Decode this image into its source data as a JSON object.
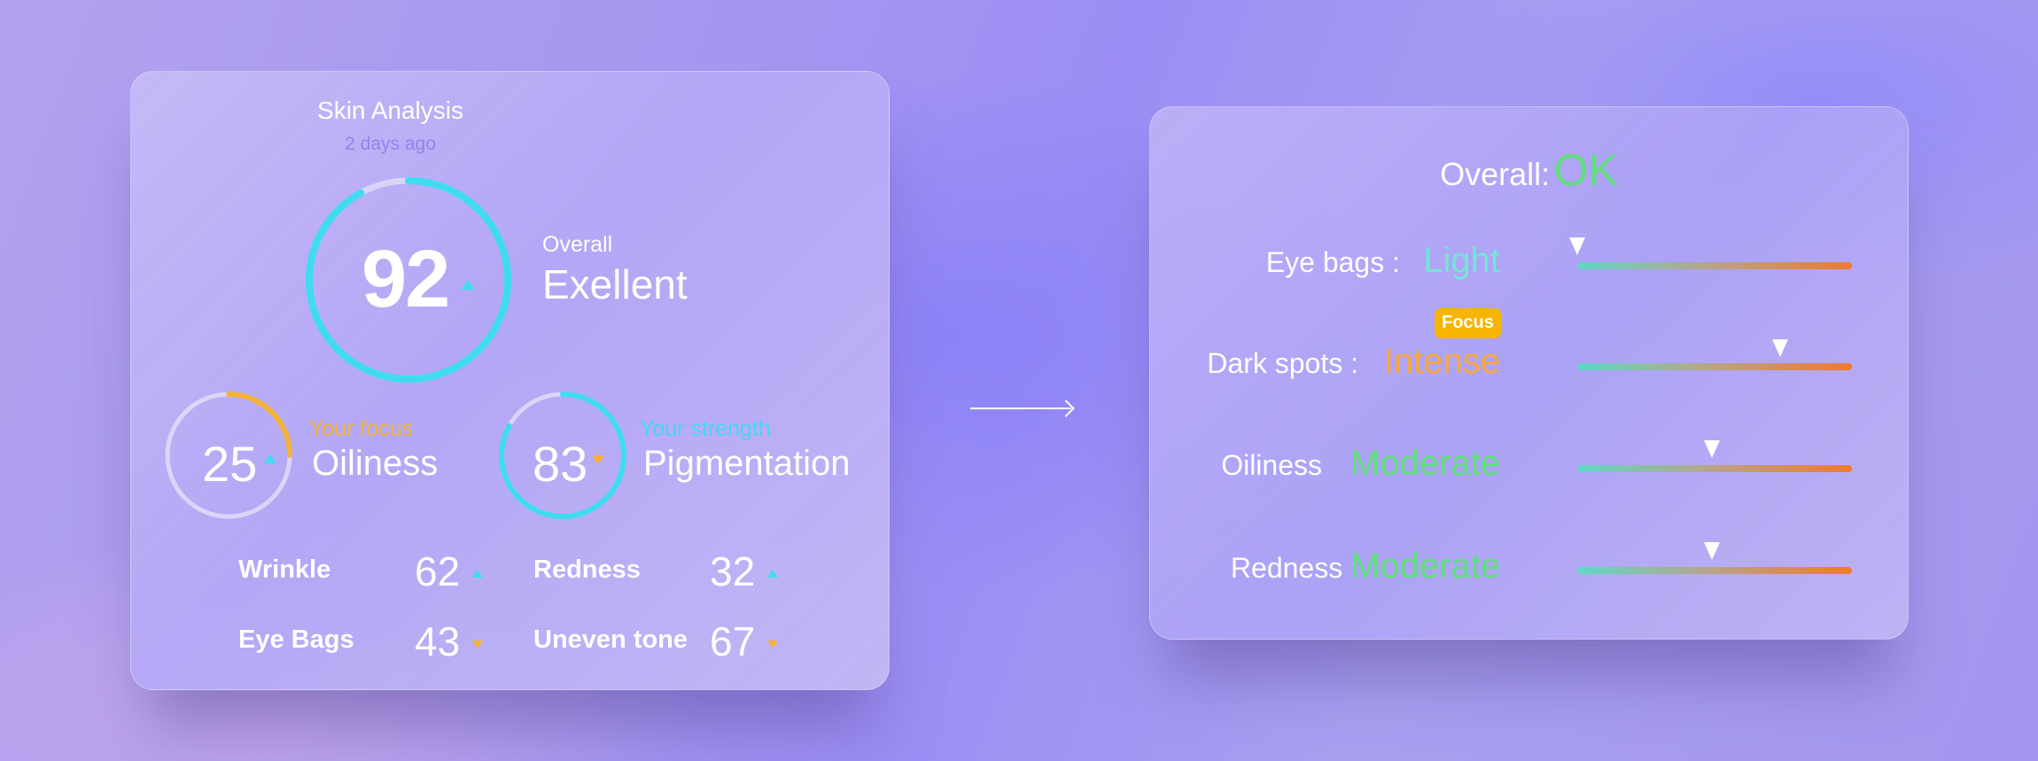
{
  "colors": {
    "cyan": "#3fdcf0",
    "orange": "#f4b23a",
    "green": "#5ee07a",
    "light_teal": "#72e6d6",
    "intense_orange": "#f7a83e",
    "focus_badge": "#f6b500"
  },
  "arrow_icon": "right-arrow-icon",
  "analysis": {
    "title": "Skin Analysis",
    "subtitle": "2 days ago",
    "overall": {
      "score": "92",
      "score_value": 92,
      "label": "Overall",
      "rating": "Exellent",
      "trend": "up"
    },
    "focus": {
      "score": "25",
      "score_value": 25,
      "tag": "Your focus",
      "name": "Oiliness",
      "trend": "up"
    },
    "strength": {
      "score": "83",
      "score_value": 83,
      "tag": "Your strength",
      "name": "Pigmentation",
      "trend": "down"
    },
    "metrics": [
      {
        "name": "Wrinkle",
        "score": "62",
        "trend": "up"
      },
      {
        "name": "Redness",
        "score": "32",
        "trend": "up"
      },
      {
        "name": "Eye Bags",
        "score": "43",
        "trend": "down"
      },
      {
        "name": "Uneven tone",
        "score": "67",
        "trend": "down"
      }
    ]
  },
  "summary": {
    "overall_label": "Overall:",
    "overall_value": "OK",
    "rows": [
      {
        "label": "Eye bags :",
        "value": "Light",
        "level": 0.0
      },
      {
        "label": "Dark spots :",
        "value": "Intense",
        "level": 0.74,
        "badge": "Focus"
      },
      {
        "label": "Oiliness",
        "value": "Moderate",
        "level": 0.49
      },
      {
        "label": "Redness :",
        "value": "Moderate",
        "level": 0.49
      }
    ]
  }
}
